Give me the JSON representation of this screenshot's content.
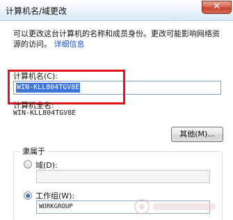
{
  "window": {
    "title": "计算机名/域更改",
    "close_glyph": "✕"
  },
  "description": {
    "text": "可以更改这台计算机的名称和成员身份。更改可能影响网络资源的访问。",
    "link": "详细信息"
  },
  "computer_name": {
    "label": "计算机名(C):",
    "value": "WIN-KLL804TGV8E",
    "highlight_color": "#e0141d"
  },
  "full_name": {
    "label": "计算机全名:",
    "value": "WIN-KLL804TGV8E"
  },
  "more_button": {
    "label": "其他(M)..."
  },
  "member_of": {
    "title": "隶属于",
    "domain": {
      "label": "域(D):",
      "selected": false,
      "value": ""
    },
    "workgroup": {
      "label": "工作组(W):",
      "selected": true,
      "value": "WORKGROUP"
    }
  },
  "colors": {
    "link": "#1a4fd0",
    "selection": "#3c75d6",
    "close_button": "#c84531"
  }
}
